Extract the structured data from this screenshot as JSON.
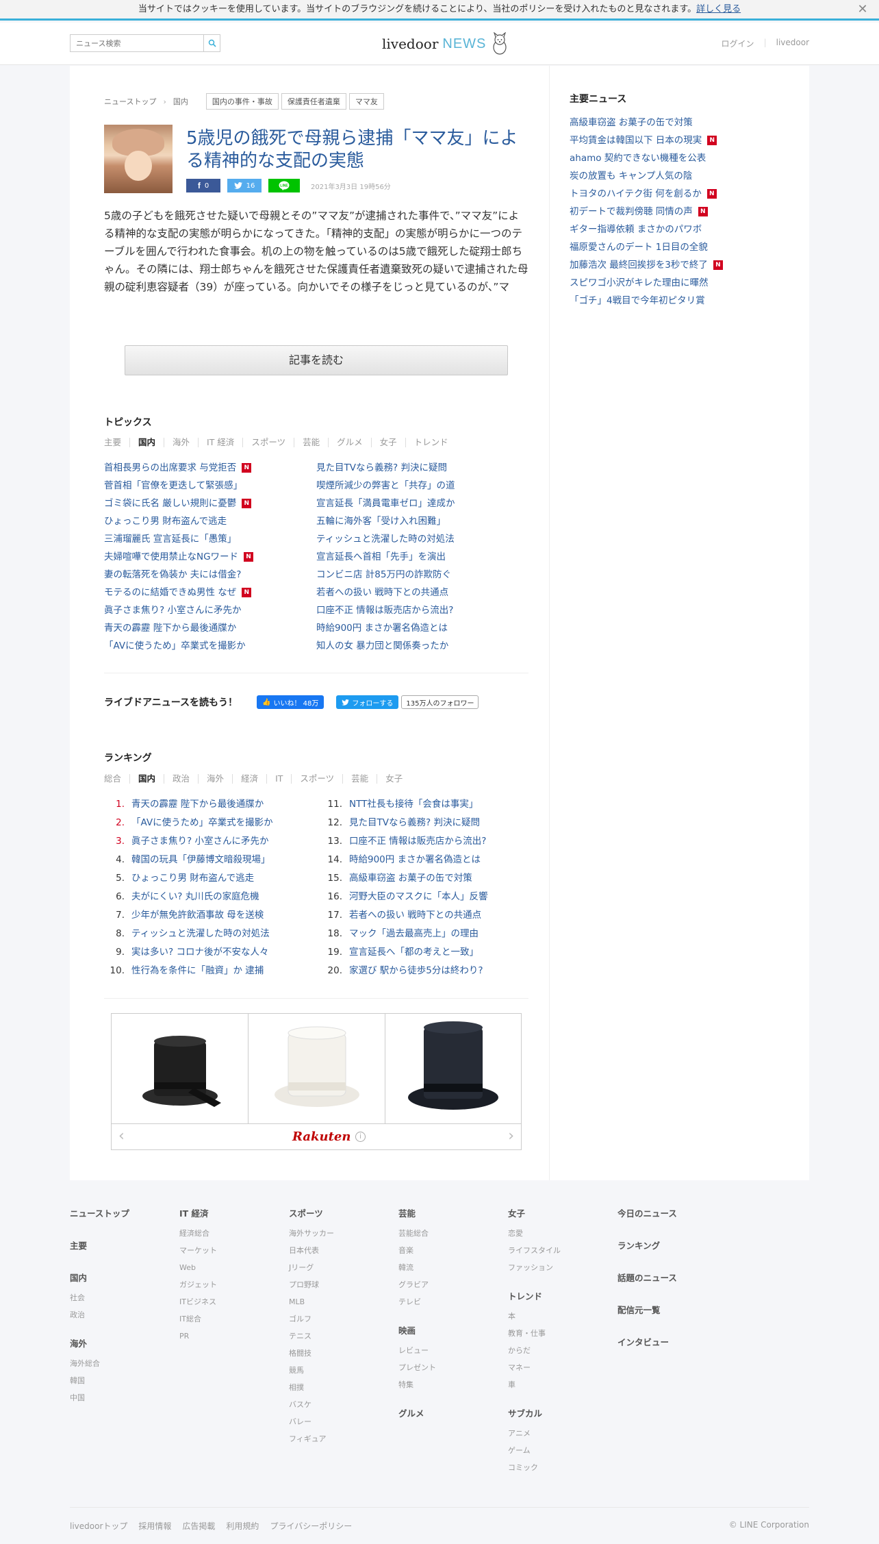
{
  "cookie": {
    "text": "当サイトではクッキーを使用しています。当サイトのブラウジングを続けることにより、当社のポリシーを受け入れたものと見なされます。",
    "link": "詳しく見る",
    "close": "✕"
  },
  "header": {
    "search_placeholder": "ニュース検索",
    "logo_main": "livedoor",
    "logo_news": "NEWS",
    "login": "ログイン",
    "site": "livedoor"
  },
  "breadcrumb": {
    "items": [
      "ニューストップ",
      "国内"
    ],
    "tags": [
      "国内の事件・事故",
      "保護責任者遺棄",
      "ママ友"
    ]
  },
  "article": {
    "title": "5歳児の餓死で母親ら逮捕「ママ友」による精神的な支配の実態",
    "fb_count": "0",
    "tw_count": "16",
    "date": "2021年3月3日 19時56分",
    "body": "5歳の子どもを餓死させた疑いで母親とその”ママ友”が逮捕された事件で、”ママ友”による精神的な支配の実態が明らかになってきた。「精神的支配」の実態が明らかに一つのテーブルを囲んで行われた食事会。机の上の物を触っているのは5歳で餓死した碇翔士郎ちゃん。その隣には、翔士郎ちゃんを餓死させた保護責任者遺棄致死の疑いで逮捕された母親の碇利恵容疑者（39）が座っている。向かいでその様子をじっと見ているのが、”マ",
    "read_button": "記事を読む"
  },
  "topics": {
    "heading": "トピックス",
    "tabs": [
      "主要",
      "国内",
      "海外",
      "IT 経済",
      "スポーツ",
      "芸能",
      "グルメ",
      "女子",
      "トレンド"
    ],
    "active_tab": "国内",
    "items": [
      {
        "text": "首相長男らの出席要求 与党拒否",
        "new": true
      },
      {
        "text": "見た目TVなら義務? 判決に疑問",
        "new": false
      },
      {
        "text": "菅首相「官僚を更迭して緊張感」",
        "new": false
      },
      {
        "text": "喫煙所減少の弊害と「共存」の道",
        "new": false
      },
      {
        "text": "ゴミ袋に氏名 厳しい規則に憂鬱",
        "new": true
      },
      {
        "text": "宣言延長「満員電車ゼロ」達成か",
        "new": false
      },
      {
        "text": "ひょっこり男 財布盗んで逃走",
        "new": false
      },
      {
        "text": "五輪に海外客「受け入れ困難」",
        "new": false
      },
      {
        "text": "三浦瑠麗氏 宣言延長に「愚策」",
        "new": false
      },
      {
        "text": "ティッシュと洗濯した時の対処法",
        "new": false
      },
      {
        "text": "夫婦喧嘩で使用禁止なNGワード",
        "new": true
      },
      {
        "text": "宣言延長へ首相「先手」を演出",
        "new": false
      },
      {
        "text": "妻の転落死を偽装か 夫には借金?",
        "new": false
      },
      {
        "text": "コンビニ店 計85万円の詐欺防ぐ",
        "new": false
      },
      {
        "text": "モテるのに結婚できぬ男性 なぜ",
        "new": true
      },
      {
        "text": "若者への扱い 戦時下との共通点",
        "new": false
      },
      {
        "text": "眞子さま焦り? 小室さんに矛先か",
        "new": false
      },
      {
        "text": "口座不正 情報は販売店から流出?",
        "new": false
      },
      {
        "text": "青天の霹靂 陛下から最後通牒か",
        "new": false
      },
      {
        "text": "時給900円 まさか署名偽造とは",
        "new": false
      },
      {
        "text": "「AVに使うため」卒業式を撮影か",
        "new": false
      },
      {
        "text": "知人の女 暴力団と関係奏ったか",
        "new": false
      }
    ]
  },
  "follow": {
    "label": "ライブドアニュースを読もう！",
    "fb_like": "いいね！ 48万",
    "tw_follow": "フォローする",
    "tw_count": "135万人のフォロワー"
  },
  "ranking": {
    "heading": "ランキング",
    "tabs": [
      "総合",
      "国内",
      "政治",
      "海外",
      "経済",
      "IT",
      "スポーツ",
      "芸能",
      "女子"
    ],
    "active_tab": "国内",
    "left": [
      {
        "num": "1.",
        "text": "青天の霹靂 陛下から最後通牒か"
      },
      {
        "num": "2.",
        "text": "「AVに使うため」卒業式を撮影か"
      },
      {
        "num": "3.",
        "text": "眞子さま焦り? 小室さんに矛先か"
      },
      {
        "num": "4.",
        "text": "韓国の玩具「伊藤博文暗殺現場」"
      },
      {
        "num": "5.",
        "text": "ひょっこり男 財布盗んで逃走"
      },
      {
        "num": "6.",
        "text": "夫がにくい? 丸川氏の家庭危機"
      },
      {
        "num": "7.",
        "text": "少年が無免許飲酒事故 母を送検"
      },
      {
        "num": "8.",
        "text": "ティッシュと洗濯した時の対処法"
      },
      {
        "num": "9.",
        "text": "実は多い? コロナ後が不安な人々"
      },
      {
        "num": "10.",
        "text": "性行為を条件に「融資」か 逮捕"
      }
    ],
    "right": [
      {
        "num": "11.",
        "text": "NTT社長も接待「会食は事実」"
      },
      {
        "num": "12.",
        "text": "見た目TVなら義務? 判決に疑問"
      },
      {
        "num": "13.",
        "text": "口座不正 情報は販売店から流出?"
      },
      {
        "num": "14.",
        "text": "時給900円 まさか署名偽造とは"
      },
      {
        "num": "15.",
        "text": "高級車窃盗 お菓子の缶で対策"
      },
      {
        "num": "16.",
        "text": "河野大臣のマスクに「本人」反響"
      },
      {
        "num": "17.",
        "text": "若者への扱い 戦時下との共通点"
      },
      {
        "num": "18.",
        "text": "マック「過去最高売上」の理由"
      },
      {
        "num": "19.",
        "text": "宣言延長へ「都の考えと一致」"
      },
      {
        "num": "20.",
        "text": "家選び 駅から徒歩5分は終わり?"
      }
    ]
  },
  "ad": {
    "brand": "Rakuten"
  },
  "sidebar": {
    "heading": "主要ニュース",
    "items": [
      {
        "text": "高級車窃盗 お菓子の缶で対策",
        "new": false
      },
      {
        "text": "平均賃金は韓国以下 日本の現実",
        "new": true
      },
      {
        "text": "ahamo 契約できない機種を公表",
        "new": false
      },
      {
        "text": "炭の放置も キャンプ人気の陰",
        "new": false
      },
      {
        "text": "トヨタのハイテク街 何を創るか",
        "new": true
      },
      {
        "text": "初デートで裁判傍聴 同情の声",
        "new": true
      },
      {
        "text": "ギター指導依頼 まさかのパワボ",
        "new": false
      },
      {
        "text": "福原愛さんのデート 1日目の全貌",
        "new": false
      },
      {
        "text": "加藤浩次 最終回挨拶を3秒で終了",
        "new": true
      },
      {
        "text": "スピワゴ小沢がキレた理由に暉然",
        "new": false
      },
      {
        "text": "「ゴチ」4戦目で今年初ピタリ賞",
        "new": false
      }
    ]
  },
  "footer": {
    "cols": [
      {
        "groups": [
          {
            "h": "ニューストップ",
            "subs": []
          },
          {
            "h": "主要",
            "subs": []
          },
          {
            "h": "国内",
            "subs": [
              "社会",
              "政治"
            ]
          },
          {
            "h": "海外",
            "subs": [
              "海外総合",
              "韓国",
              "中国"
            ]
          }
        ]
      },
      {
        "groups": [
          {
            "h": "IT 経済",
            "subs": [
              "経済総合",
              "マーケット",
              "Web",
              "ガジェット",
              "ITビジネス",
              "IT総合",
              "PR"
            ]
          }
        ]
      },
      {
        "groups": [
          {
            "h": "スポーツ",
            "subs": [
              "海外サッカー",
              "日本代表",
              "Jリーグ",
              "プロ野球",
              "MLB",
              "ゴルフ",
              "テニス",
              "格闘技",
              "競馬",
              "相撲",
              "バスケ",
              "バレー",
              "フィギュア"
            ]
          }
        ]
      },
      {
        "groups": [
          {
            "h": "芸能",
            "subs": [
              "芸能総合",
              "音楽",
              "韓流",
              "グラビア",
              "テレビ"
            ]
          },
          {
            "h": "映画",
            "subs": [
              "レビュー",
              "プレゼント",
              "特集"
            ]
          },
          {
            "h": "グルメ",
            "subs": []
          }
        ]
      },
      {
        "groups": [
          {
            "h": "女子",
            "subs": [
              "恋愛",
              "ライフスタイル",
              "ファッション"
            ]
          },
          {
            "h": "トレンド",
            "subs": [
              "本",
              "教育・仕事",
              "からだ",
              "マネー",
              "車"
            ]
          },
          {
            "h": "サブカル",
            "subs": [
              "アニメ",
              "ゲーム",
              "コミック"
            ]
          }
        ]
      },
      {
        "groups": [
          {
            "h": "今日のニュース",
            "subs": []
          },
          {
            "h": "ランキング",
            "subs": []
          },
          {
            "h": "話題のニュース",
            "subs": []
          },
          {
            "h": "配信元一覧",
            "subs": []
          },
          {
            "h": "インタビュー",
            "subs": []
          }
        ]
      }
    ],
    "bottom_links": [
      "livedoorトップ",
      "採用情報",
      "広告掲載",
      "利用規約",
      "プライバシーポリシー"
    ],
    "copyright": "© LINE Corporation"
  },
  "colors": {
    "link": "#2a5b9c",
    "accent": "#3ab0d9",
    "new_badge": "#d1001f"
  }
}
